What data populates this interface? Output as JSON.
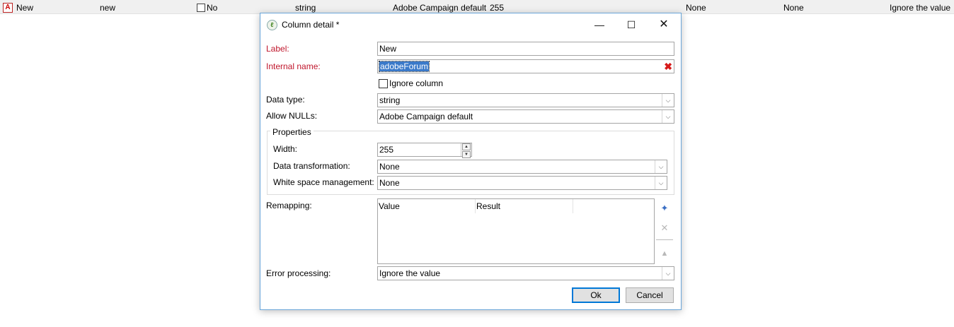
{
  "background_row": {
    "name": "New",
    "internal_name": "new",
    "ignore_label": "No",
    "data_type": "string",
    "allow_nulls": "Adobe Campaign default",
    "width": "255",
    "data_transformation": "None",
    "white_space": "None",
    "error_processing": "Ignore the value"
  },
  "dialog": {
    "title": "Column detail *",
    "label_caption": "Label:",
    "label_value": "New",
    "internal_name_caption": "Internal name:",
    "internal_name_value": "adobeForum",
    "ignore_column_label": "Ignore column",
    "data_type_caption": "Data type:",
    "data_type_value": "string",
    "allow_nulls_caption": "Allow NULLs:",
    "allow_nulls_value": "Adobe Campaign default",
    "properties": {
      "title": "Properties",
      "width_caption": "Width:",
      "width_value": "255",
      "data_transformation_caption": "Data transformation:",
      "data_transformation_value": "None",
      "white_space_caption": "White space management:",
      "white_space_value": "None"
    },
    "remapping": {
      "caption": "Remapping:",
      "columns": [
        "Value",
        "Result"
      ]
    },
    "error_processing_caption": "Error processing:",
    "error_processing_value": "Ignore the value",
    "ok_label": "Ok",
    "cancel_label": "Cancel"
  },
  "colors": {
    "required_label": "#c0162c",
    "selection": "#3a79c9",
    "dialog_border": "#6aa6d9"
  }
}
